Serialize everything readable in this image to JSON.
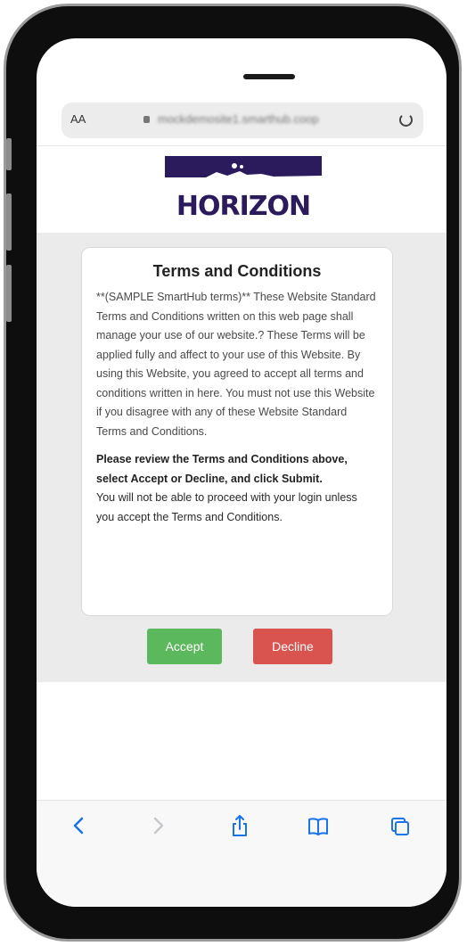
{
  "browser": {
    "text_size_label": "AA",
    "url": "mockdemosite1.smarthub.coop"
  },
  "logo": {
    "wordmark": "HORIZON"
  },
  "terms": {
    "title": "Terms and Conditions",
    "body": "**(SAMPLE SmartHub terms)** These Website Standard Terms and Conditions written on this web page shall manage your use of our website.? These Terms will be applied fully and affect to your use of this Website. By using this Website, you agreed to accept all terms and conditions written in here. You must not use this Website if you disagree with any of these Website Standard Terms and Conditions.",
    "instruction_bold": "Please review the Terms and Conditions above, select Accept or Decline, and click Submit.",
    "instruction_note": "You will not be able to proceed with your login unless you accept the Terms and Conditions."
  },
  "actions": {
    "accept_label": "Accept",
    "decline_label": "Decline"
  },
  "colors": {
    "brand": "#2b1a5c",
    "accept": "#5cb85c",
    "decline": "#d9534f",
    "ios_blue": "#1a73e8"
  },
  "toolbar": {
    "icons": [
      "back-icon",
      "forward-icon",
      "share-icon",
      "bookmarks-icon",
      "tabs-icon"
    ]
  }
}
